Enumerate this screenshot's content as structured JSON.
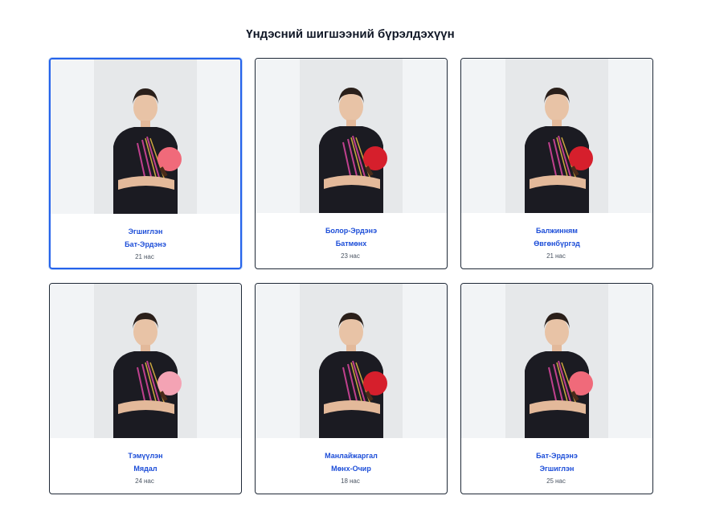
{
  "page": {
    "title": "Үндэсний шигшээний бүрэлдэхүүн"
  },
  "colors": {
    "accent": "#1d4ed8",
    "selected_border": "#2563eb",
    "photo_bg": "#f2f4f6"
  },
  "players": [
    {
      "first_name": "Эгшиглэн",
      "last_name": "Бат-Эрдэнэ",
      "age": "21",
      "age_unit": "нас",
      "paddle_color": "#f06a7a",
      "selected": true
    },
    {
      "first_name": "Болор-Эрдэнэ",
      "last_name": "Батмөнх",
      "age": "23",
      "age_unit": "нас",
      "paddle_color": "#d61f2c",
      "selected": false
    },
    {
      "first_name": "Балжинням",
      "last_name": "Өвгөнбүргэд",
      "age": "21",
      "age_unit": "нас",
      "paddle_color": "#d61f2c",
      "selected": false
    },
    {
      "first_name": "Тэмүүлэн",
      "last_name": "Мядал",
      "age": "24",
      "age_unit": "нас",
      "paddle_color": "#f4a3b4",
      "selected": false
    },
    {
      "first_name": "Манлайжаргал",
      "last_name": "Мөнх-Очир",
      "age": "18",
      "age_unit": "нас",
      "paddle_color": "#d61f2c",
      "selected": false
    },
    {
      "first_name": "Бат-Эрдэнэ",
      "last_name": "Эгшиглэн",
      "age": "25",
      "age_unit": "нас",
      "paddle_color": "#f06a7a",
      "selected": false
    }
  ]
}
